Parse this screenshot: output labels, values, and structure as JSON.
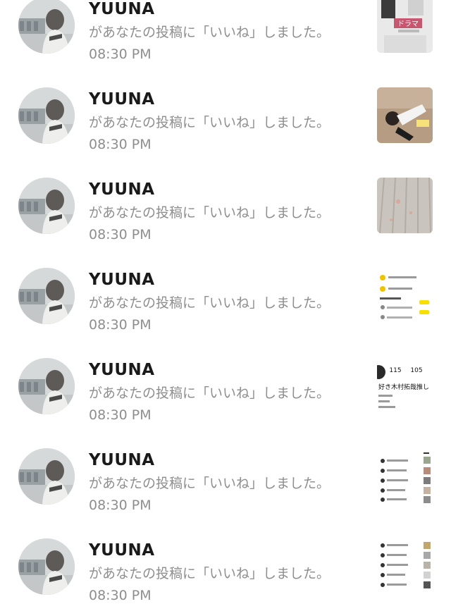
{
  "notifications": [
    {
      "name": "YUUNA",
      "message": "があなたの投稿に「いいね」しました。",
      "time": "08:30 PM",
      "thumb_icon": "drama-poster-thumbnail",
      "thumb_text": "ドラマ"
    },
    {
      "name": "YUUNA",
      "message": "があなたの投稿に「いいね」しました。",
      "time": "08:30 PM",
      "thumb_icon": "person-photo-thumbnail"
    },
    {
      "name": "YUUNA",
      "message": "があなたの投稿に「いいね」しました。",
      "time": "08:30 PM",
      "thumb_icon": "floor-photo-thumbnail"
    },
    {
      "name": "YUUNA",
      "message": "があなたの投稿に「いいね」しました。",
      "time": "08:30 PM",
      "thumb_icon": "app-list-screenshot-thumbnail"
    },
    {
      "name": "YUUNA",
      "message": "があなたの投稿に「いいね」しました。",
      "time": "08:30 PM",
      "thumb_icon": "profile-screenshot-thumbnail",
      "thumb_stats": [
        "115",
        "105"
      ],
      "thumb_text": "好き木村拓哉推し"
    },
    {
      "name": "YUUNA",
      "message": "があなたの投稿に「いいね」しました。",
      "time": "08:30 PM",
      "thumb_icon": "comment-list-screenshot-thumbnail"
    },
    {
      "name": "YUUNA",
      "message": "があなたの投稿に「いいね」しました。",
      "time": "08:30 PM",
      "thumb_icon": "comment-list-screenshot-thumbnail"
    }
  ],
  "colors": {
    "name": "#1a1a1a",
    "secondary_text": "#8e8e8e",
    "background": "#ffffff"
  }
}
